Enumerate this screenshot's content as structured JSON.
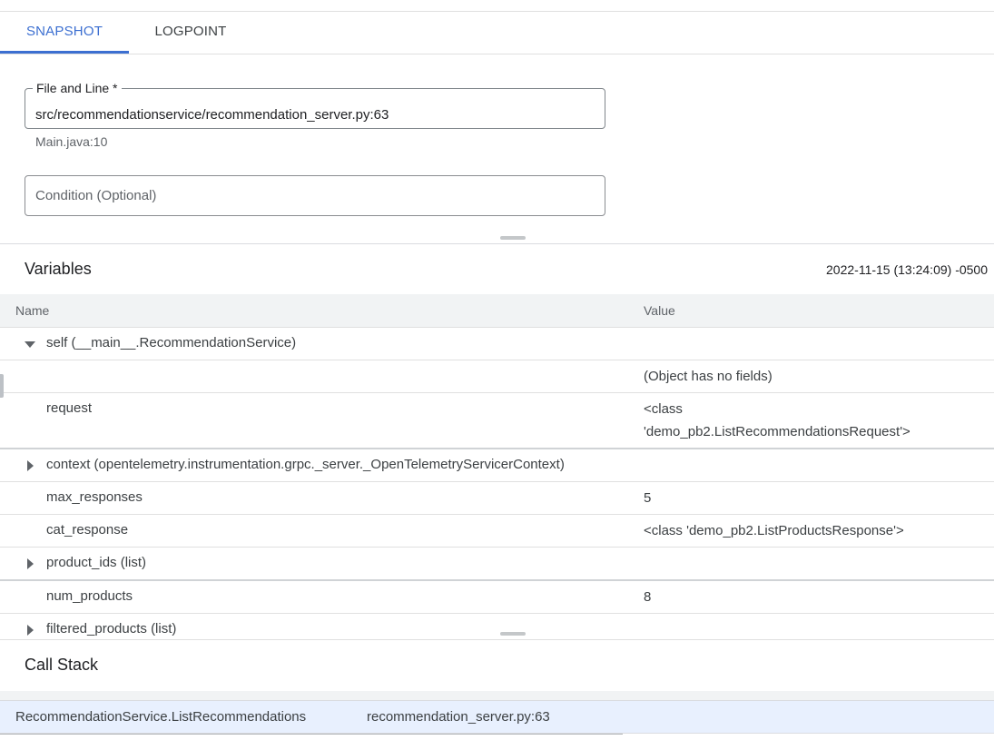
{
  "tabs": [
    {
      "label": "SNAPSHOT",
      "active": true
    },
    {
      "label": "LOGPOINT",
      "active": false
    }
  ],
  "form": {
    "file_label": "File and Line *",
    "file_value": "src/recommendationservice/recommendation_server.py:63",
    "file_hint": "Main.java:10",
    "condition_placeholder": "Condition (Optional)"
  },
  "variables": {
    "title": "Variables",
    "timestamp": "2022-11-15 (13:24:09) -0500",
    "columns": {
      "name": "Name",
      "value": "Value"
    },
    "rows": [
      {
        "name": "self (__main__.RecommendationService)",
        "value": "",
        "caret": "expanded"
      },
      {
        "name": "",
        "value": "(Object has no fields)",
        "caret": "none"
      },
      {
        "name": "request",
        "value": "<class 'demo_pb2.ListRecommendationsRequest'>",
        "caret": "none"
      },
      {
        "name": "context (opentelemetry.instrumentation.grpc._server._OpenTelemetryServicerContext)",
        "value": "",
        "caret": "collapsed"
      },
      {
        "name": "max_responses",
        "value": "5",
        "caret": "none"
      },
      {
        "name": "cat_response",
        "value": "<class 'demo_pb2.ListProductsResponse'>",
        "caret": "none"
      },
      {
        "name": "product_ids (list)",
        "value": "",
        "caret": "collapsed"
      },
      {
        "name": "num_products",
        "value": "8",
        "caret": "none"
      },
      {
        "name": "filtered_products (list)",
        "value": "",
        "caret": "collapsed"
      }
    ]
  },
  "call_stack": {
    "title": "Call Stack",
    "frames": [
      {
        "function": "RecommendationService.ListRecommendations",
        "location": "recommendation_server.py:63"
      }
    ]
  },
  "icons": {
    "expanded": "caret-down-icon",
    "collapsed": "caret-right-icon"
  },
  "colors": {
    "accent": "#3c6fd1",
    "selected_row": "#e8f0fe",
    "header_bg": "#f1f3f4"
  }
}
